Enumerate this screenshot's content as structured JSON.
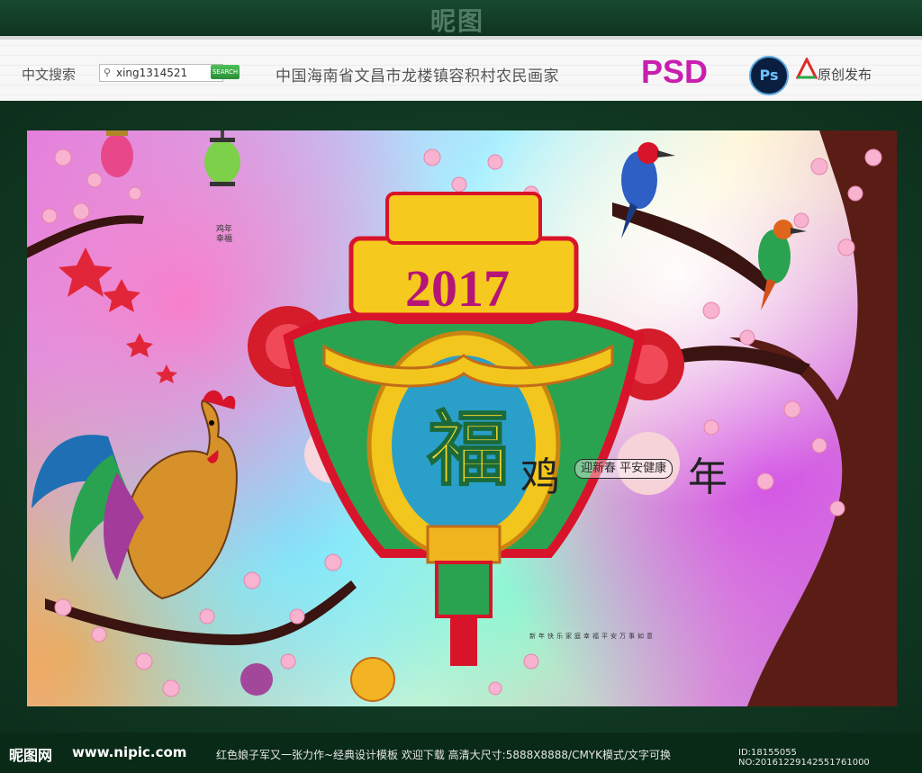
{
  "header": {
    "search_label": "中文搜索",
    "search_value": "xing1314521",
    "search_button": "SEARCH",
    "address": "中国海南省文昌市龙楼镇容积村农民画家",
    "format_label": "PSD",
    "ps_badge": "Ps",
    "original_label": "原创发布",
    "watermark_top": "昵图"
  },
  "poster": {
    "year_text": "2017",
    "fu_char": "福",
    "ji_char": "鸡",
    "nian_char": "年",
    "slogan": "迎新春 平安健康",
    "small_line": "新年快乐家庭幸福平安万事如意",
    "vertical_text": "鸡年幸福",
    "colors": {
      "red": "#d8142a",
      "gold": "#f7c623",
      "green": "#2ba44f",
      "blue": "#1d73c8",
      "pink": "#f7a8c8"
    }
  },
  "footer": {
    "logo": "昵图网",
    "url": "www.nipic.com",
    "description": "红色娘子军又一张力作~经典设计模板   欢迎下载  高清大尺寸:5888X8888/CMYK模式/文字可换",
    "id_text": "ID:18155055 NO:20161229142551761000"
  }
}
